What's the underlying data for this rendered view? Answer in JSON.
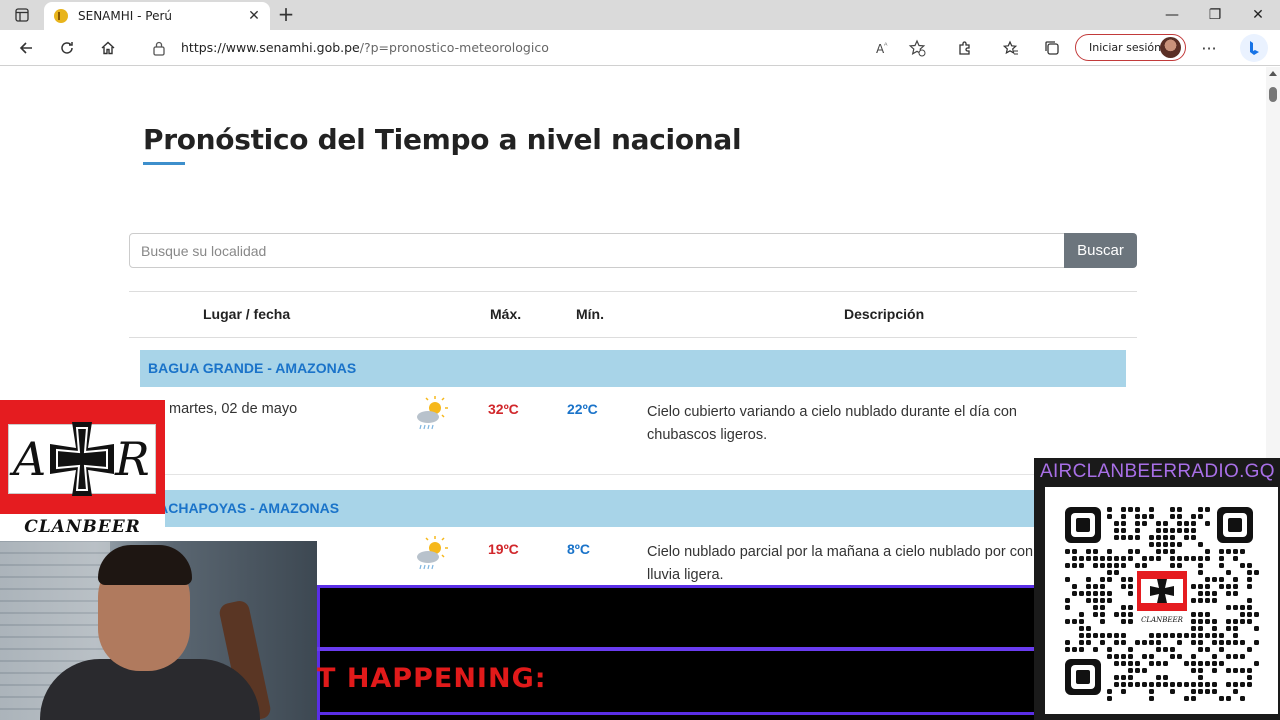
{
  "browser": {
    "tab_title": "SENAMHI - Perú",
    "url_host": "https://www.senamhi.gob.pe",
    "url_path": "/?p=pronostico-meteorologico",
    "signin_label": "Iniciar sesión"
  },
  "page": {
    "title": "Pronóstico del Tiempo a nivel nacional",
    "search_placeholder": "Busque su localidad",
    "search_button": "Buscar",
    "columns": {
      "place": "Lugar / fecha",
      "max": "Máx.",
      "min": "Mín.",
      "desc": "Descripción"
    },
    "locations": [
      {
        "name": "BAGUA GRANDE - AMAZONAS",
        "date": "martes, 02 de mayo",
        "icon": "partly-cloudy-rain-icon",
        "max": "32ºC",
        "min": "22ºC",
        "desc": "Cielo cubierto variando a cielo nublado durante el día con chubascos ligeros."
      },
      {
        "name": "HACHAPOYAS - AMAZONAS",
        "date": "",
        "icon": "partly-cloudy-rain-icon",
        "max": "19ºC",
        "min": "8ºC",
        "desc": "Cielo nublado parcial por la mañana a cielo nublado por con lluvia ligera."
      }
    ]
  },
  "overlay": {
    "logo_left": "A",
    "logo_right": "R",
    "logo_caption": "CLANBEER",
    "banner_text": "T HAPPENING:",
    "qr_title": "AIRCLANBEERRADIO.GQ",
    "qr_caption": "CLANBEER"
  },
  "colors": {
    "accent": "#3d8fcc",
    "loc_band": "#a8d4e8",
    "max_temp": "#d1272b",
    "min_temp": "#1a73c9",
    "button": "#6c757d"
  }
}
